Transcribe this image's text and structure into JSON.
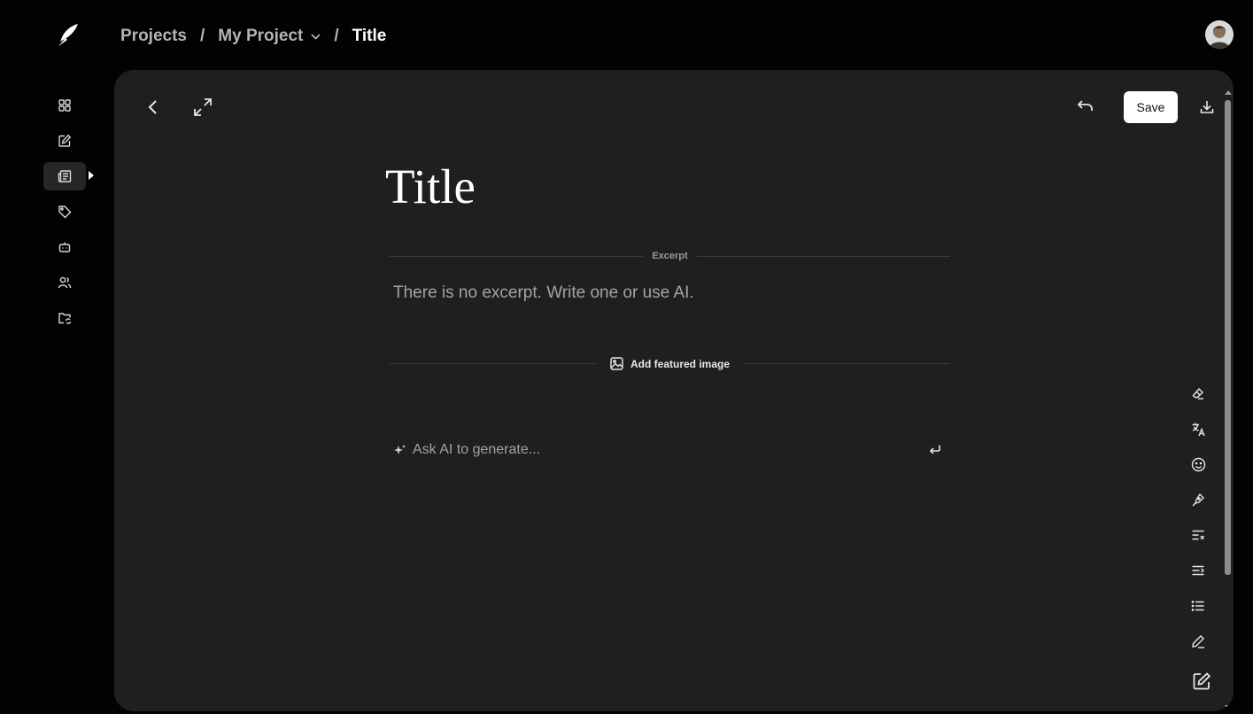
{
  "breadcrumb": {
    "projects": "Projects",
    "project": "My Project",
    "separator": "/",
    "current": "Title"
  },
  "sidebar": {
    "items": [
      {
        "name": "dashboard",
        "icon": "grid-icon"
      },
      {
        "name": "edit",
        "icon": "edit-square-icon"
      },
      {
        "name": "articles",
        "icon": "newspaper-icon",
        "active": true
      },
      {
        "name": "tags",
        "icon": "tag-icon"
      },
      {
        "name": "bots",
        "icon": "robot-icon"
      },
      {
        "name": "users",
        "icon": "users-icon"
      },
      {
        "name": "folders",
        "icon": "folder-sync-icon"
      }
    ]
  },
  "toolbar": {
    "save_label": "Save"
  },
  "editor": {
    "title": "Title",
    "excerpt_label": "Excerpt",
    "excerpt_placeholder": "There is no excerpt. Write one or use AI.",
    "featured_image_label": "Add featured image",
    "ai_placeholder": "Ask AI to generate..."
  },
  "right_tools": [
    "eraser-icon",
    "translate-icon",
    "smiley-icon",
    "pen-nib-icon",
    "text-clear-icon",
    "text-indent-icon",
    "list-icon",
    "pencil-icon",
    "edit-square-icon"
  ],
  "colors": {
    "background": "#020202",
    "panel": "#1f1f1f",
    "accent_button": "#ffffff"
  }
}
